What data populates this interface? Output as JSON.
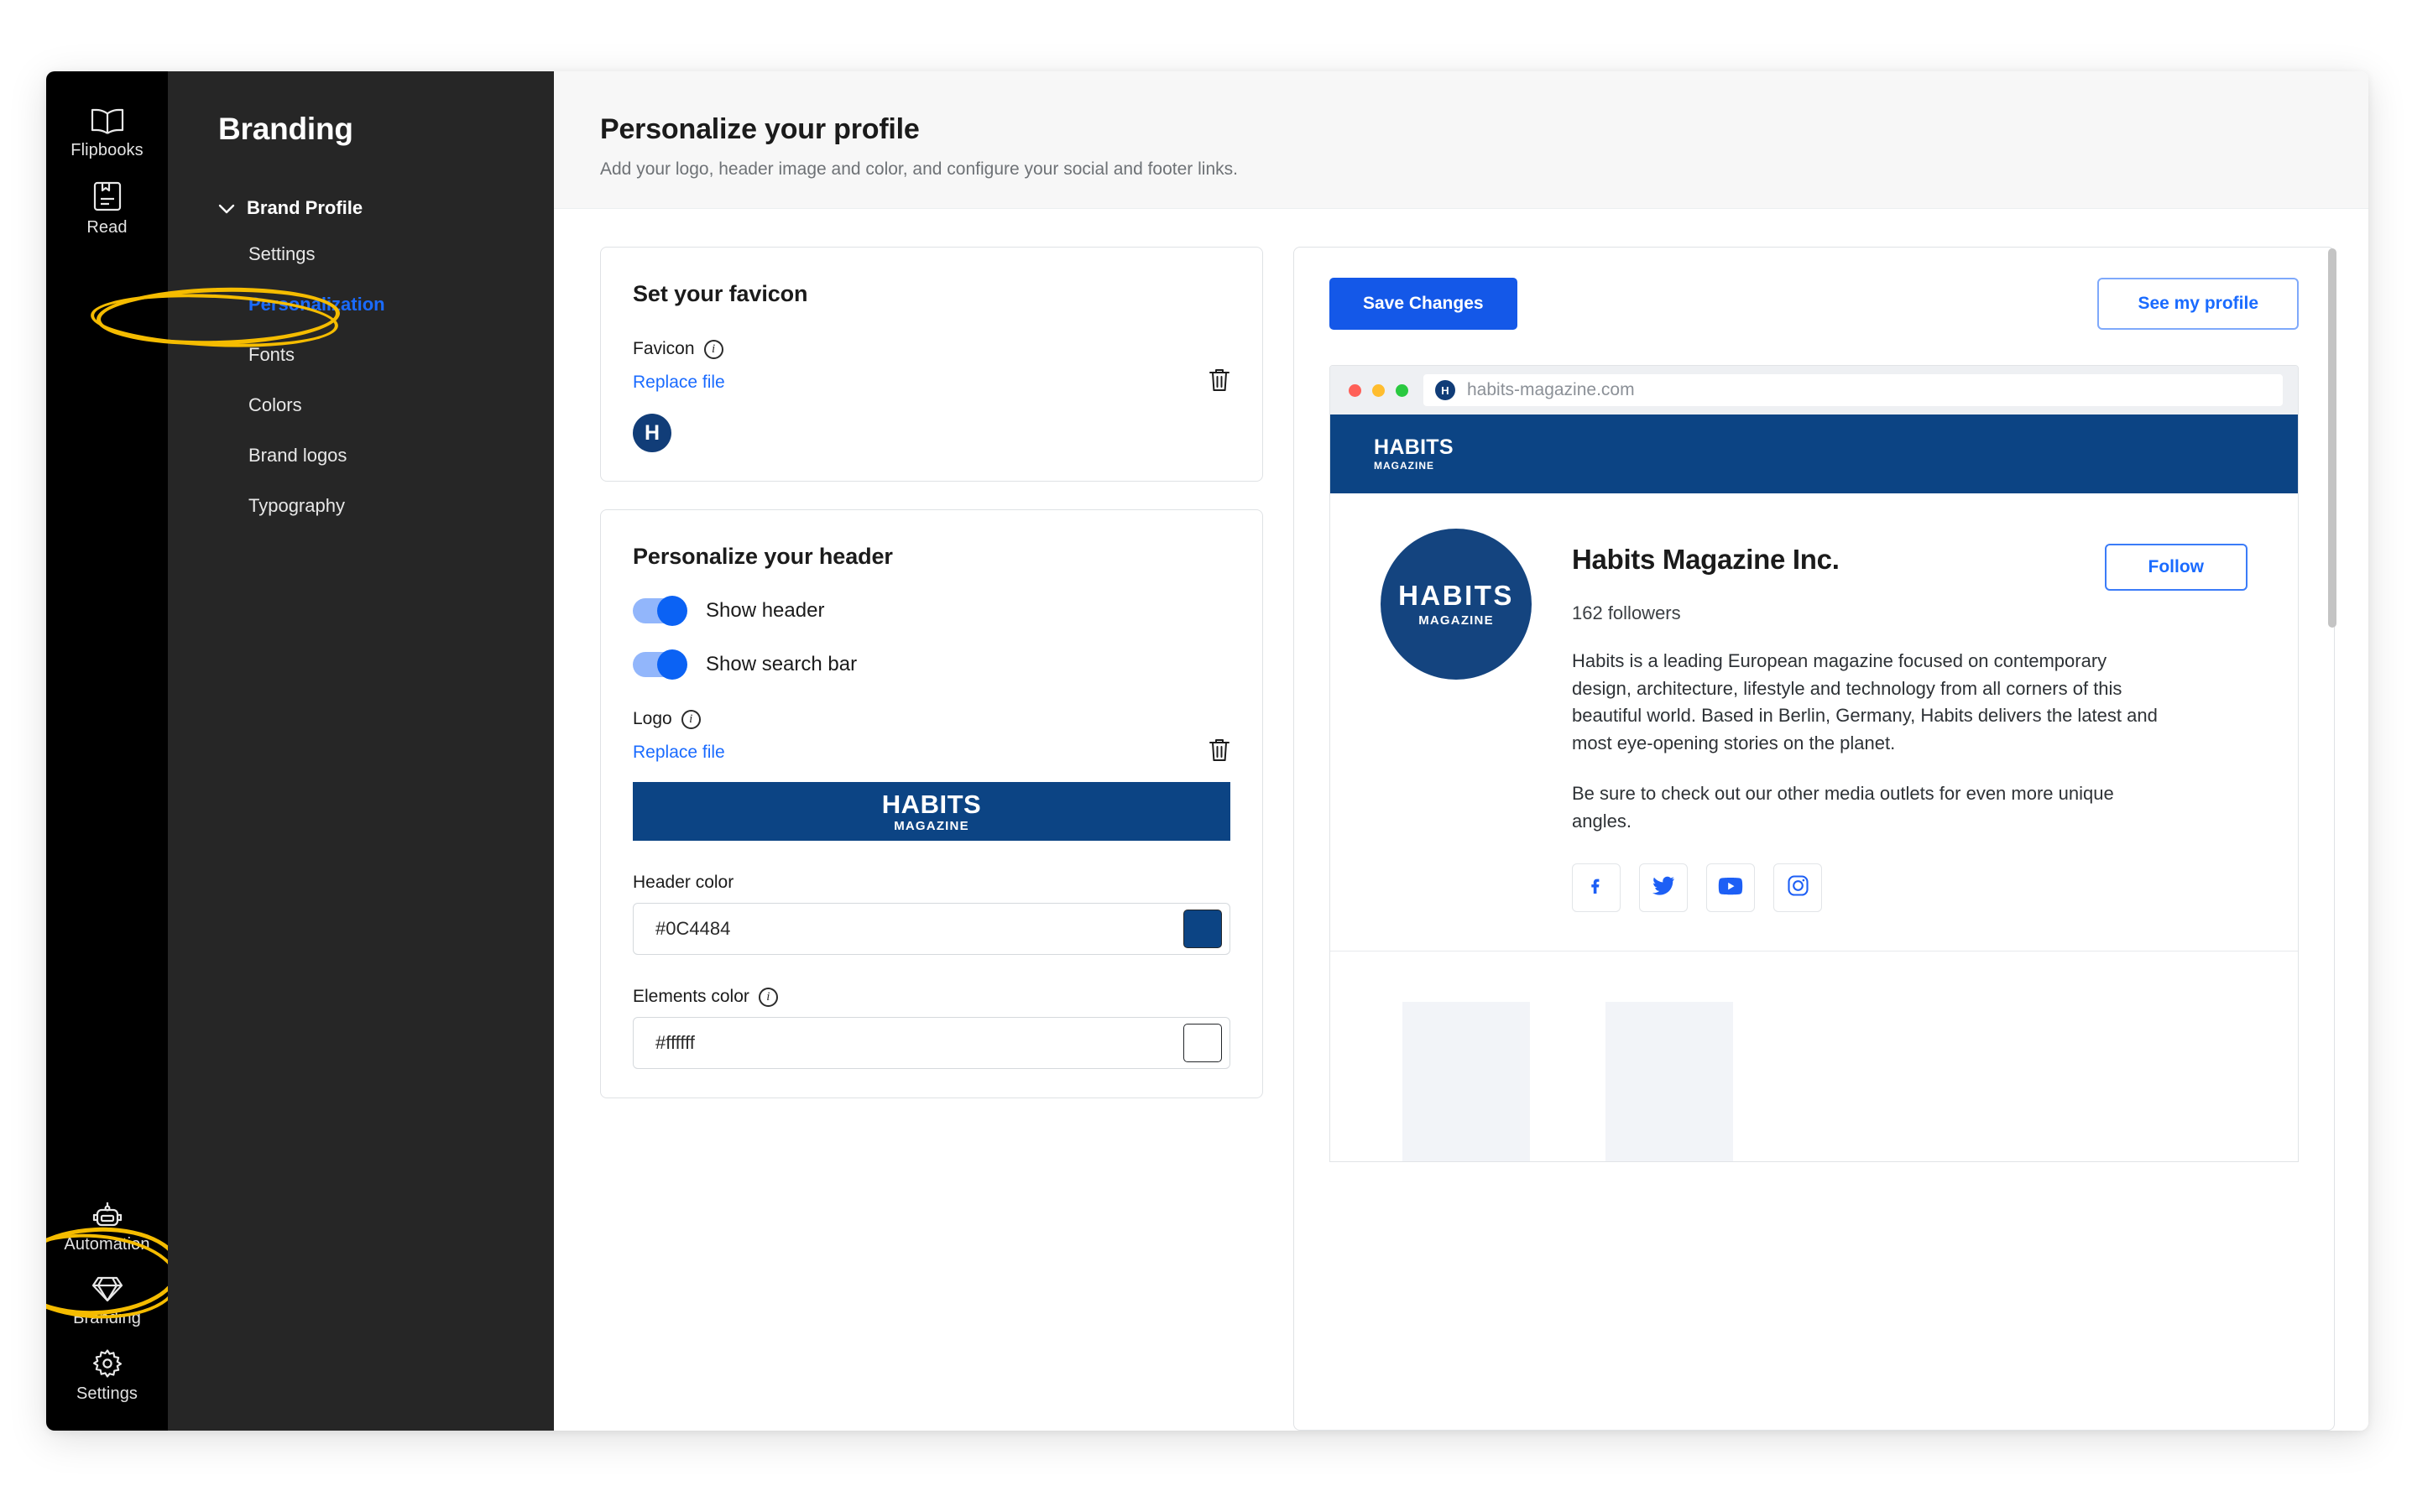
{
  "rail": {
    "top_items": [
      {
        "label": "Flipbooks",
        "icon": "book-open-icon"
      },
      {
        "label": "Read",
        "icon": "document-read-icon"
      }
    ],
    "bottom_items": [
      {
        "label": "Automation",
        "icon": "robot-icon"
      },
      {
        "label": "Branding",
        "icon": "diamond-icon"
      },
      {
        "label": "Settings",
        "icon": "gear-icon"
      }
    ]
  },
  "sidebar": {
    "title": "Branding",
    "group_label": "Brand Profile",
    "items": [
      {
        "label": "Settings",
        "active": false
      },
      {
        "label": "Personalization",
        "active": true
      },
      {
        "label": "Fonts",
        "active": false
      },
      {
        "label": "Colors",
        "active": false
      },
      {
        "label": "Brand logos",
        "active": false
      },
      {
        "label": "Typography",
        "active": false
      }
    ]
  },
  "header": {
    "title": "Personalize your profile",
    "subtitle": "Add your logo, header image and color, and configure your social and footer links."
  },
  "favicon_card": {
    "title": "Set your favicon",
    "field_label": "Favicon",
    "info_glyph": "i",
    "replace_label": "Replace file",
    "favicon_letter": "H",
    "favicon_color": "#113d78"
  },
  "header_card": {
    "title": "Personalize your header",
    "toggles": [
      {
        "label": "Show header",
        "on": true
      },
      {
        "label": "Show search bar",
        "on": true
      }
    ],
    "logo_label": "Logo",
    "info_glyph": "i",
    "replace_label": "Replace file",
    "logo_banner": {
      "primary": "HABITS",
      "secondary": "MAGAZINE",
      "bg": "#0c4484"
    },
    "header_color": {
      "label": "Header color",
      "value": "#0C4484",
      "swatch": "#0c4484"
    },
    "elements_color": {
      "label": "Elements color",
      "value": "#ffffff",
      "swatch": "#ffffff"
    }
  },
  "preview": {
    "save_label": "Save Changes",
    "see_profile_label": "See my profile",
    "browser": {
      "url": "habits-magazine.com",
      "favicon_letter": "H",
      "dots": [
        "#ff6058",
        "#ffbd2e",
        "#2ac940"
      ]
    },
    "site_header": {
      "primary": "HABITS",
      "secondary": "MAGAZINE"
    },
    "profile": {
      "logo_primary": "HABITS",
      "logo_secondary": "MAGAZINE",
      "name": "Habits Magazine Inc.",
      "follow_label": "Follow",
      "followers": "162 followers",
      "bio_1": "Habits is a leading European magazine focused on contemporary design, architecture, lifestyle and technology from all corners of this beautiful world. Based in Berlin, Germany, Habits delivers the latest and most eye-opening stories on the planet.",
      "bio_2": "Be sure to check out our other media outlets for even more unique angles.",
      "socials": [
        {
          "name": "facebook-icon"
        },
        {
          "name": "twitter-icon"
        },
        {
          "name": "youtube-icon"
        },
        {
          "name": "instagram-icon"
        }
      ]
    }
  },
  "annotations": {
    "highlight_color": "#f5bc00",
    "circled": [
      "Personalization",
      "Branding"
    ]
  }
}
